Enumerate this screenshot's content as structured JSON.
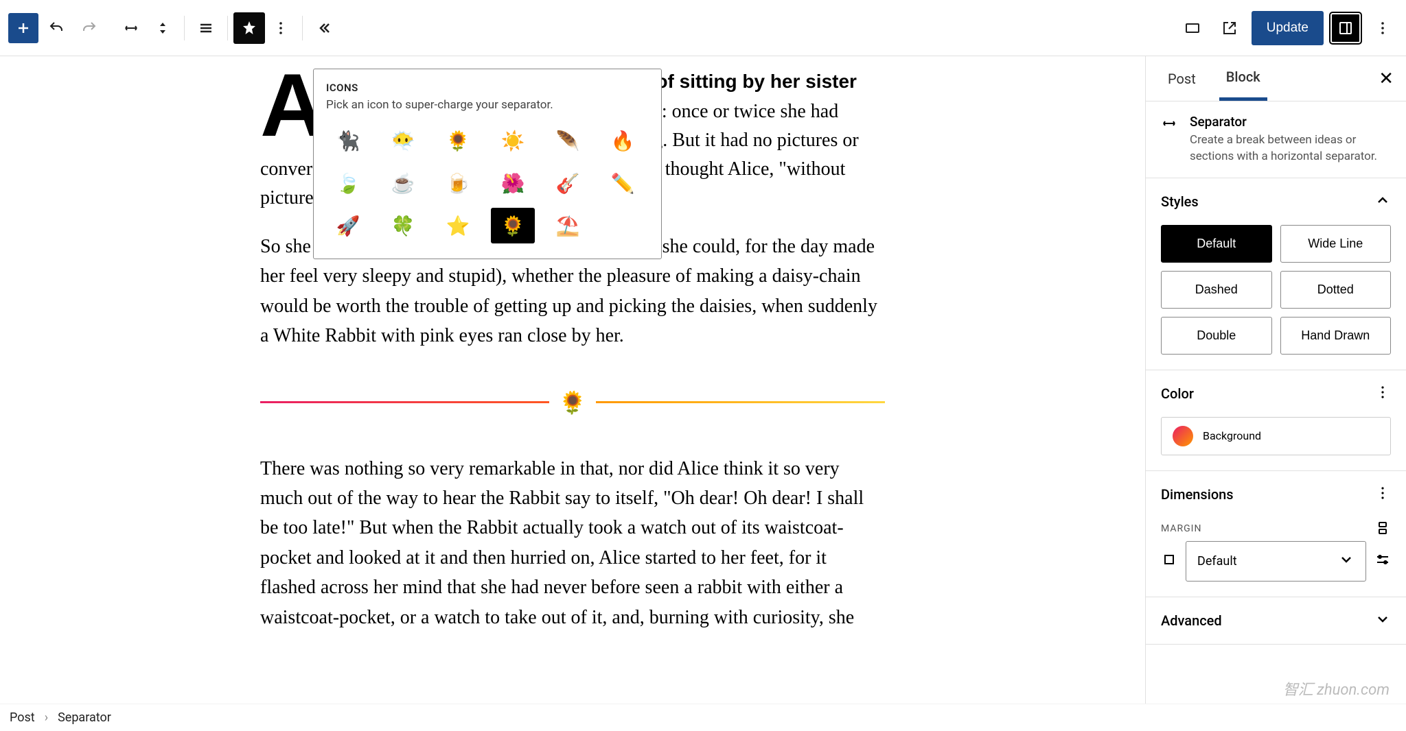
{
  "toolbar": {
    "update_label": "Update"
  },
  "popover": {
    "title": "ICONS",
    "subtitle": "Pick an icon to super-charge your separator.",
    "icons": [
      "🐈‍⬛",
      "😶‍🌫️",
      "🌻",
      "☀️",
      "🪶",
      "🔥",
      "🍃",
      "☕",
      "🍺",
      "🌺",
      "🎸",
      "✏️",
      "🚀",
      "🍀",
      "⭐",
      "🌻",
      "⛱️"
    ],
    "selected_index": 15
  },
  "content": {
    "para1_lead": "Alice was beginning to get very tired of sitting by her sister on the bank, ",
    "para1_rest": "and of having nothing to do: once or twice she had peeped into the book her sister was reading. But it had no pictures or conversations in it. \"And what is the use of a book,\" thought Alice, \"without pictures or conversations?\"",
    "para2": "So she was considering in her own mind (as well as she could, for the day made her feel very sleepy and stupid), whether the pleasure of making a daisy-chain would be worth the trouble of getting up and picking the daisies, when suddenly a White Rabbit with pink eyes ran close by her.",
    "para3": "There was nothing so very remarkable in that, nor did Alice think it so very much out of the way to hear the Rabbit say to itself, \"Oh dear! Oh dear! I shall be too late!\" But when the Rabbit actually took a watch out of its waistcoat-pocket and looked at it and then hurried on, Alice started to her feet, for it flashed across her mind that she had never before seen a rabbit with either a waistcoat-pocket, or a watch to take out of it, and, burning with curiosity, she",
    "sep_icon": "🌻"
  },
  "sidebar": {
    "tabs": {
      "post": "Post",
      "block": "Block"
    },
    "block_name": "Separator",
    "block_desc": "Create a break between ideas or sections with a horizontal separator.",
    "styles_label": "Styles",
    "styles": [
      "Default",
      "Wide Line",
      "Dashed",
      "Dotted",
      "Double",
      "Hand Drawn"
    ],
    "styles_active": 0,
    "color_label": "Color",
    "background_label": "Background",
    "dimensions_label": "Dimensions",
    "margin_label": "MARGIN",
    "margin_value": "Default",
    "advanced_label": "Advanced"
  },
  "breadcrumb": {
    "root": "Post",
    "current": "Separator"
  },
  "watermark": "智汇 zhuon.com"
}
